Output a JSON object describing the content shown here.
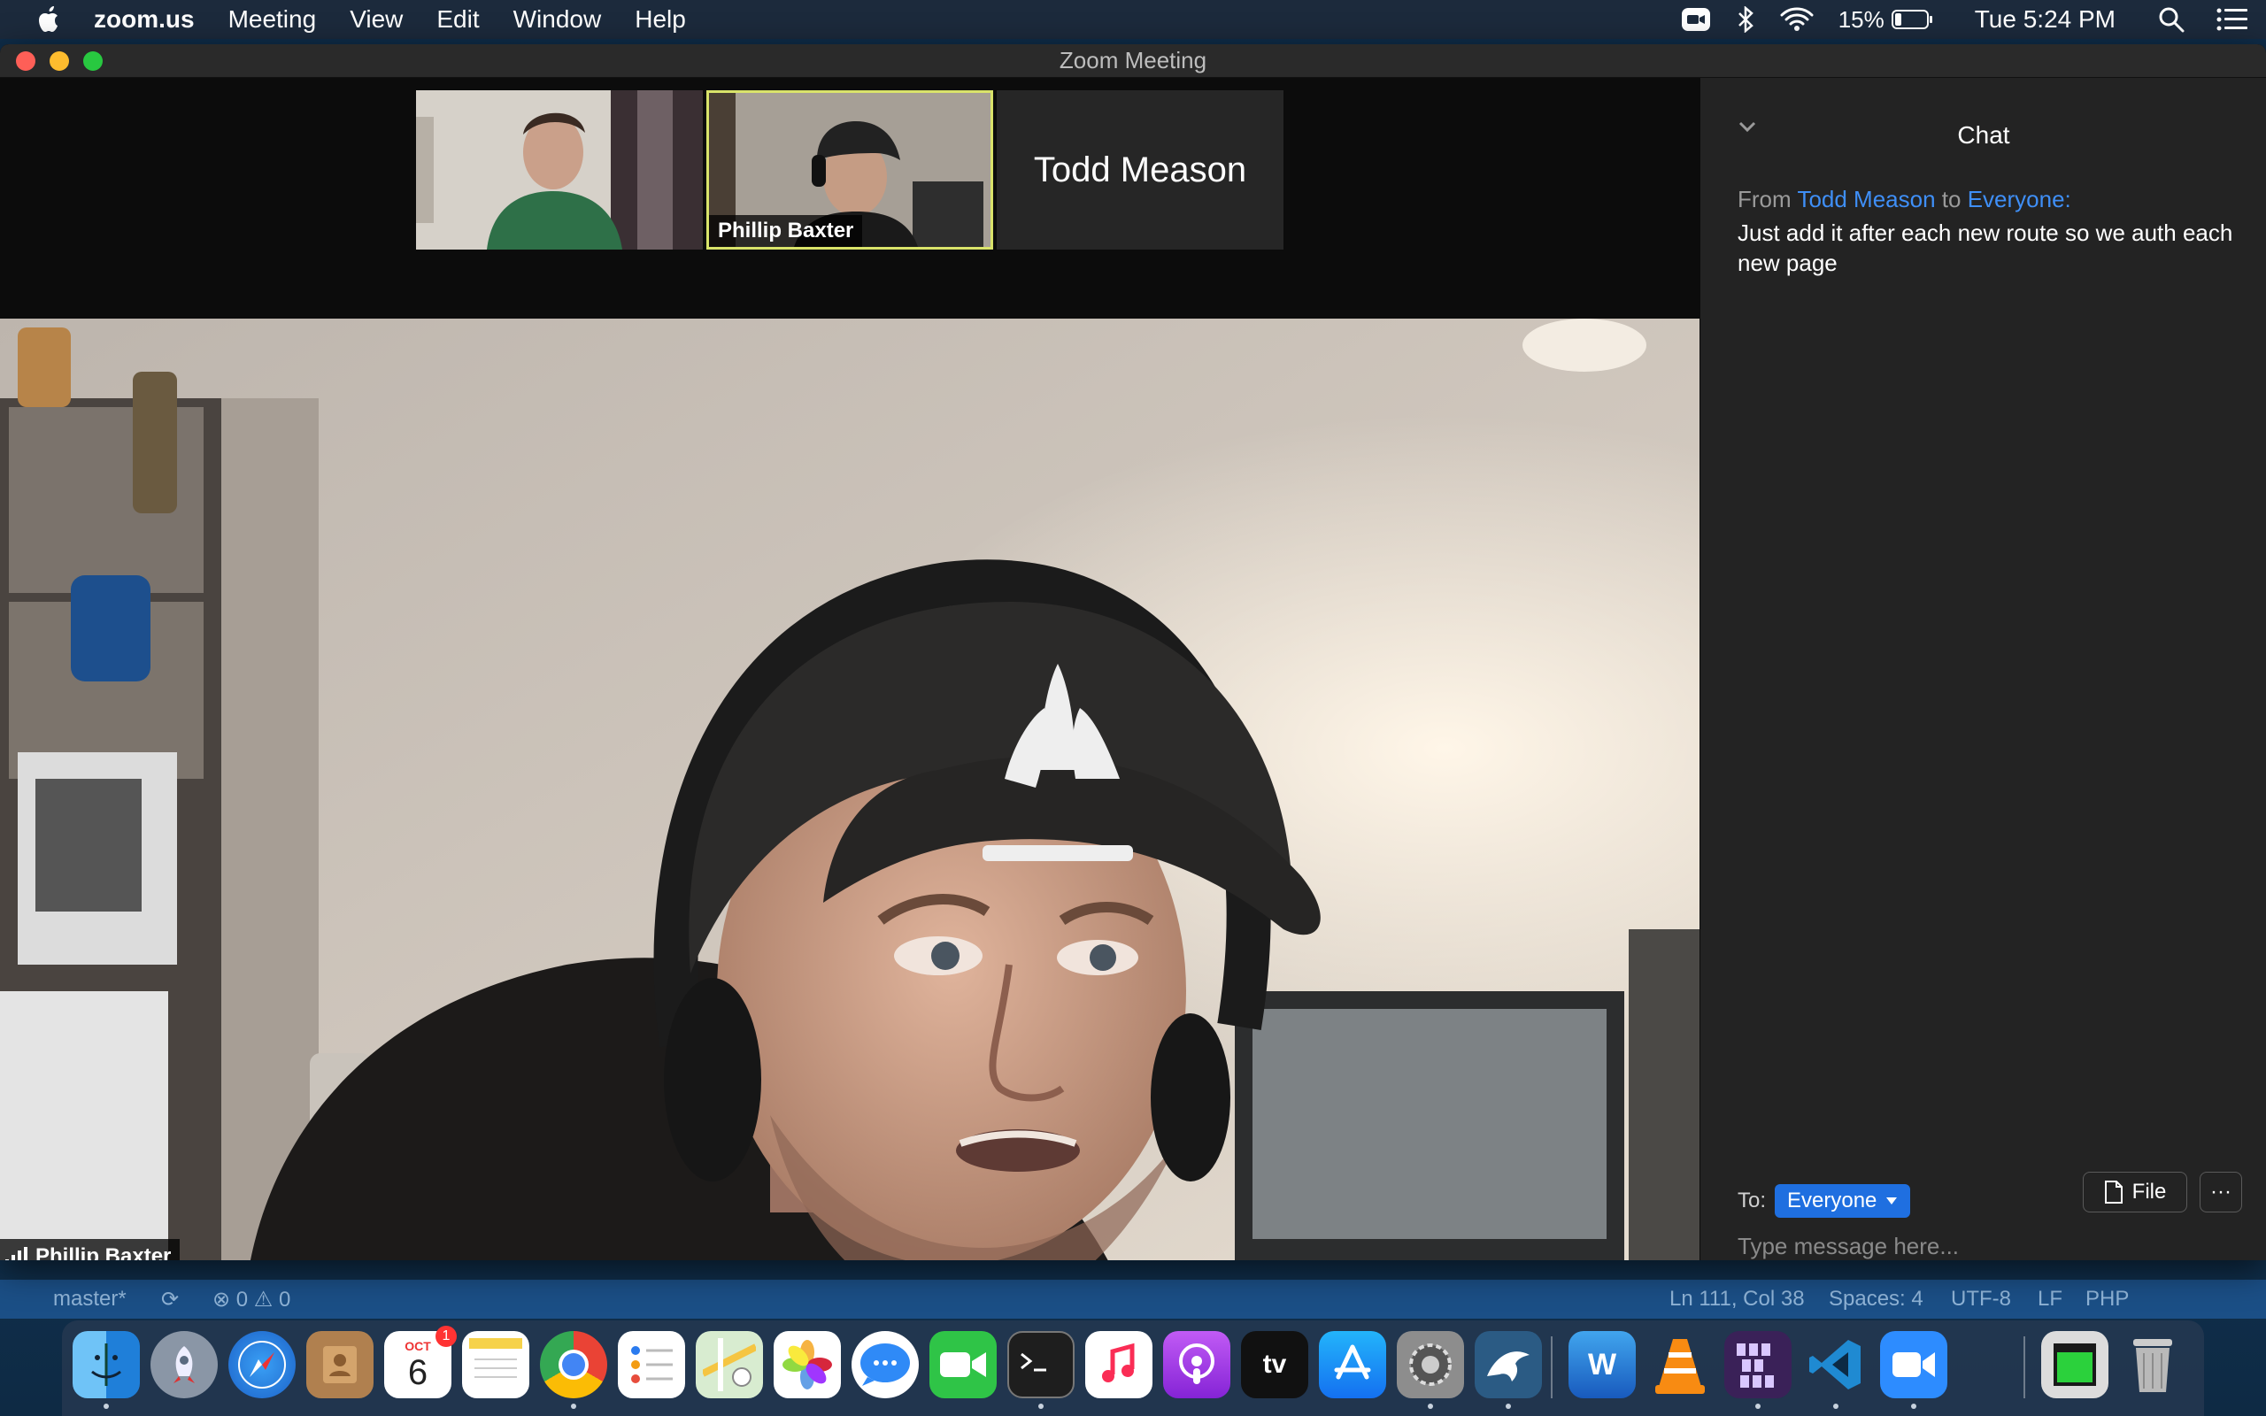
{
  "menubar": {
    "app_name": "zoom.us",
    "menus": [
      "Meeting",
      "View",
      "Edit",
      "Window",
      "Help"
    ],
    "battery": "15%",
    "clock": "Tue 5:24 PM",
    "icons": [
      "apple-icon",
      "zoom-status-icon",
      "bluetooth-icon",
      "wifi-icon",
      "battery-icon",
      "spotlight-icon",
      "notification-center-icon"
    ]
  },
  "window": {
    "title": "Zoom Meeting"
  },
  "participants": {
    "thumbnails": [
      {
        "name": "",
        "has_video": true
      },
      {
        "name": "Phillip Baxter",
        "has_video": true,
        "active_speaker": true
      },
      {
        "name": "Todd Meason",
        "has_video": false
      }
    ],
    "main_speaker": "Phillip Baxter"
  },
  "chat": {
    "title": "Chat",
    "message": {
      "from_prefix": "From",
      "sender": "Todd Meason",
      "to_word": "to",
      "recipient": "Everyone:",
      "text": "Just add it after each new route so we auth each new page"
    },
    "to_label": "To:",
    "to_value": "Everyone",
    "file_label": "File",
    "more_label": "···",
    "input_placeholder": "Type message here..."
  },
  "editor_status": {
    "branch": "master*",
    "problems": "⊗ 0 ⚠ 0",
    "position": "Ln 111, Col 38",
    "spaces": "Spaces: 4",
    "encoding": "UTF-8",
    "eol": "LF",
    "language": "PHP"
  },
  "dock": {
    "calendar_month": "OCT",
    "calendar_day": "6",
    "calendar_badge": "1",
    "tv_label": "tv",
    "word_letter": "W",
    "apps": [
      "Finder",
      "Launchpad",
      "Safari",
      "Contacts",
      "Calendar",
      "Notes",
      "Chrome",
      "Reminders",
      "Maps",
      "Photos",
      "Messages",
      "FaceTime",
      "Terminal",
      "Music",
      "Podcasts",
      "TV",
      "App Store",
      "System Preferences",
      "MySQL Workbench",
      "Word",
      "VLC",
      "DGS",
      "VS Code",
      "Zoom",
      "Activity Monitor",
      "Trash"
    ]
  }
}
